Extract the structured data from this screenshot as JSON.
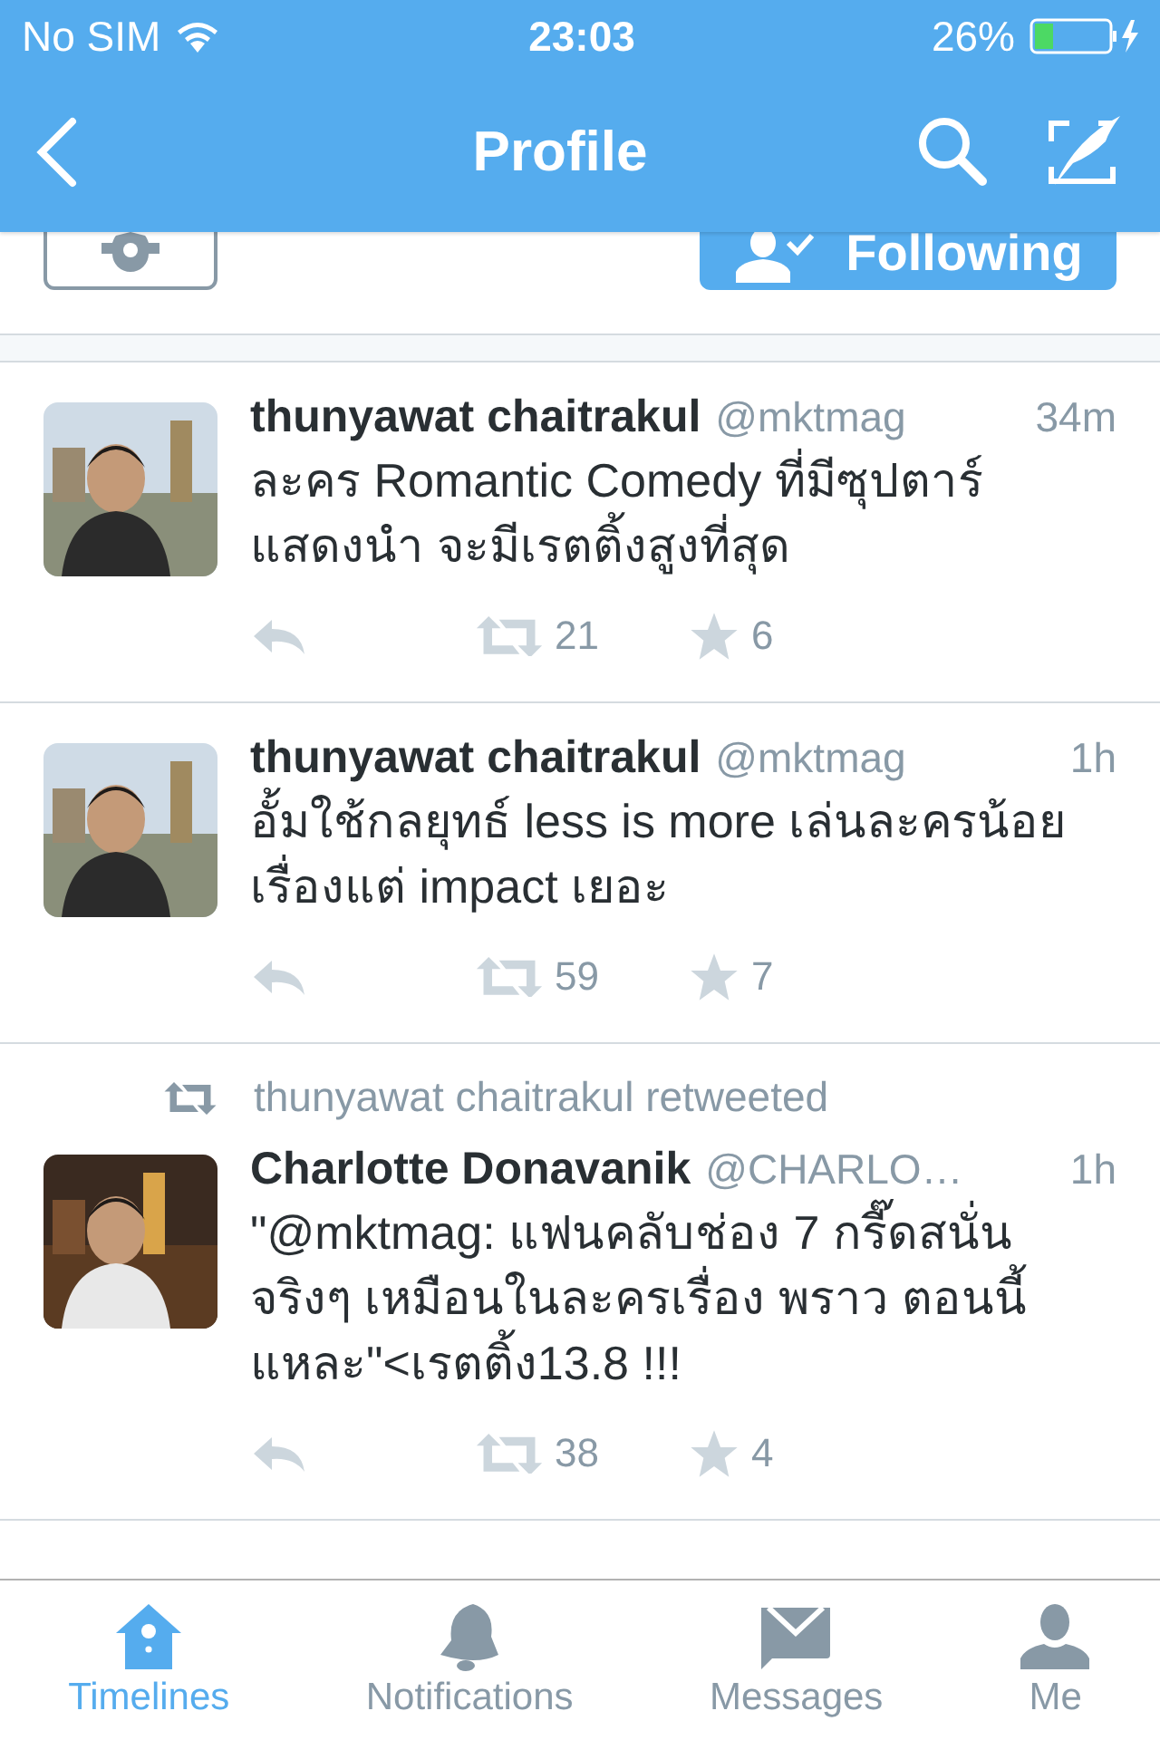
{
  "status_bar": {
    "carrier": "No SIM",
    "time": "23:03",
    "battery": "26%"
  },
  "nav": {
    "title": "Profile"
  },
  "profile_actions": {
    "follow_label": "Following"
  },
  "tweets": [
    {
      "kind": "tweet",
      "name": "thunyawat chaitrakul",
      "handle": "@mktmag",
      "time": "34m",
      "text": "ละคร Romantic Comedy ที่มีซุปตาร์แสดงนำ จะมีเรตติ้งสูงที่สุด",
      "retweets": "21",
      "favorites": "6"
    },
    {
      "kind": "tweet",
      "name": "thunyawat chaitrakul",
      "handle": "@mktmag",
      "time": "1h",
      "text": "อั้มใช้กลยุทธ์ less is more เล่นละครน้อยเรื่องแต่ impact เยอะ",
      "retweets": "59",
      "favorites": "7"
    },
    {
      "kind": "retweet",
      "retweeted_by": "thunyawat chaitrakul retweeted",
      "name": "Charlotte Donavanik",
      "handle": "@CHARLO…",
      "time": "1h",
      "text": "\"@mktmag: แฟนคลับช่อง 7 กรี๊ดสนั่นจริงๆ เหมือนในละครเรื่อง พราว ตอนนี้แหละ\"<เรตติ้ง13.8 !!!",
      "retweets": "38",
      "favorites": "4"
    }
  ],
  "tab_bar": [
    {
      "label": "Timelines",
      "selected": true
    },
    {
      "label": "Notifications",
      "selected": false
    },
    {
      "label": "Messages",
      "selected": false
    },
    {
      "label": "Me",
      "selected": false
    }
  ]
}
